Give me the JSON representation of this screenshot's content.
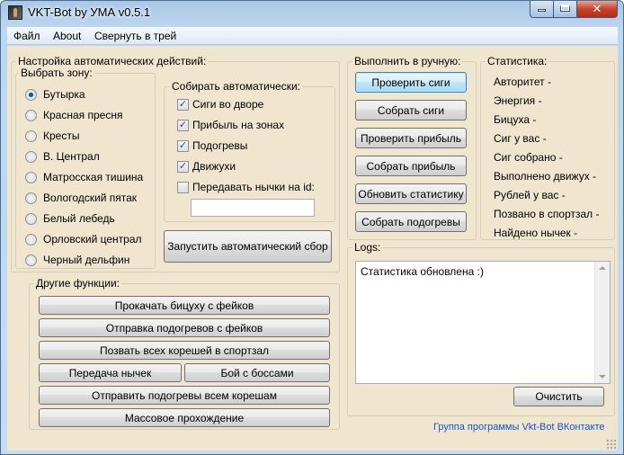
{
  "window": {
    "title": "VKT-Bot by УМА v0.5.1"
  },
  "menu": {
    "file": "Файл",
    "about": "About",
    "tray": "Свернуть в трей"
  },
  "auto": {
    "legend": "Настройка автоматических действий:",
    "zone": {
      "legend": "Выбрать зону:",
      "selected_index": 0,
      "items": [
        "Бутырка",
        "Красная пресня",
        "Кресты",
        "В. Централ",
        "Матросская тишина",
        "Вологодский пятак",
        "Белый лебедь",
        "Орловский централ",
        "Черный дельфин"
      ]
    },
    "collect": {
      "legend": "Собирать автоматически:",
      "items": [
        {
          "label": "Сиги во дворе",
          "checked": true
        },
        {
          "label": "Прибыль на зонах",
          "checked": true
        },
        {
          "label": "Подогревы",
          "checked": true
        },
        {
          "label": "Движухи",
          "checked": true
        },
        {
          "label": "Передавать нычки на id:",
          "checked": false
        }
      ],
      "id_value": ""
    },
    "start_button": "Запустить автоматический сбор"
  },
  "manual": {
    "legend": "Выполнить в ручную:",
    "buttons": [
      "Проверить сиги",
      "Собрать сиги",
      "Проверить прибыль",
      "Собрать прибыль",
      "Обновить статистику",
      "Собрать подогревы"
    ]
  },
  "stats": {
    "legend": "Статистика:",
    "lines": [
      "Авторитет -",
      "Энергия -",
      "Бицуха -",
      "Сиг у вас -",
      "Сиг собрано  -",
      "Выполнено движух -",
      "Рублей у вас -",
      "Позвано в спортзал -",
      "Найдено нычек -"
    ]
  },
  "other": {
    "legend": "Другие функции:",
    "pump": "Прокачать бицуху с фейков",
    "send_warm": "Отправка подогревов с фейков",
    "gym": "Позвать всех корешей в спортзал",
    "stash": "Передача нычек",
    "boss": "Бой с боссами",
    "send_all": "Отправить подогревы всем корешам",
    "mass": "Массовое прохождение"
  },
  "logs": {
    "legend": "Logs:",
    "text": "Статистика обновлена :)",
    "clear_button": "Очистить"
  },
  "footer": {
    "link": "Группа программы Vkt-Bot ВКонтакте"
  }
}
